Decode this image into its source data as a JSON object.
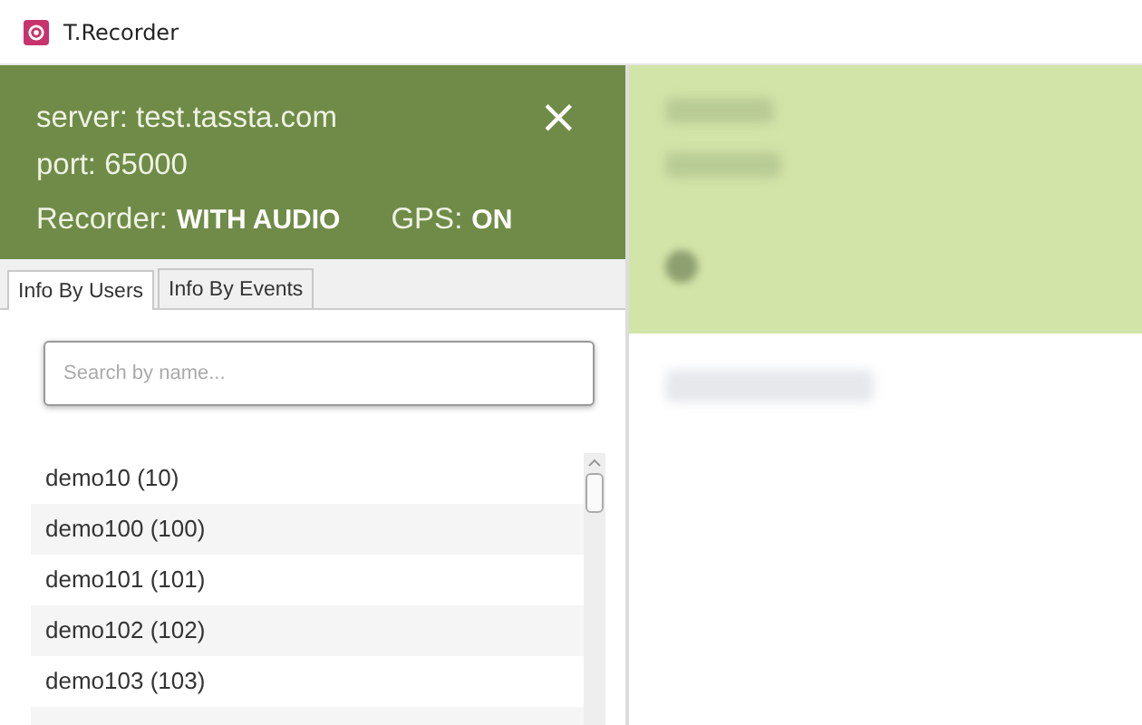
{
  "window": {
    "title": "T.Recorder"
  },
  "header": {
    "server": "server: test.tassta.com",
    "port": "port: 65000",
    "recorder_label": "Recorder:",
    "recorder_value": "WITH AUDIO",
    "gps_label": "GPS:",
    "gps_value": "ON",
    "close": "×"
  },
  "tabs": [
    {
      "label": "Info By Users",
      "selected": true
    },
    {
      "label": "Info By Events",
      "selected": false
    }
  ],
  "search": {
    "placeholder": "Search by name..."
  },
  "users": [
    "demo10 (10)",
    "demo100 (100)",
    "demo101 (101)",
    "demo102 (102)",
    "demo103 (103)"
  ]
}
